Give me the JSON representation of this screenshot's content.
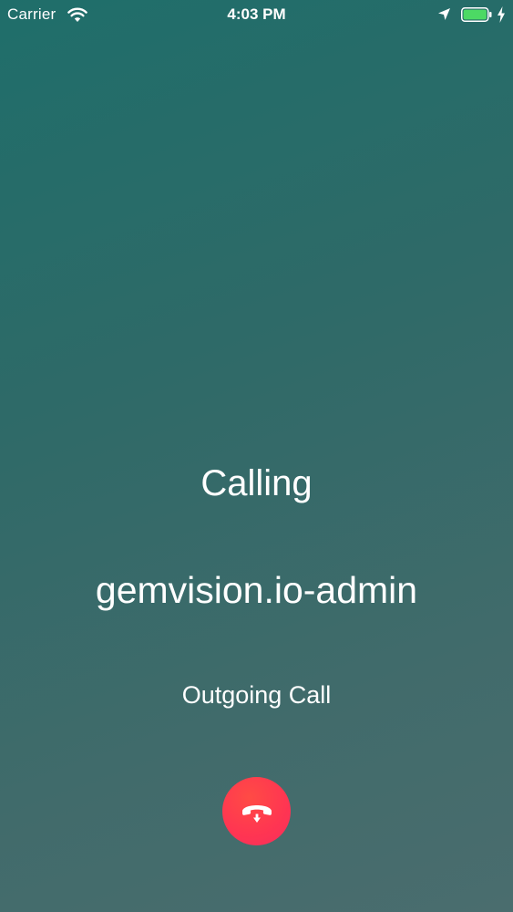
{
  "status_bar": {
    "carrier": "Carrier",
    "time": "4:03 PM",
    "wifi_icon": "wifi-icon",
    "location_icon": "location-arrow-icon",
    "battery_icon": "battery-icon",
    "charging_icon": "charging-bolt-icon",
    "battery_color": "#4cd964"
  },
  "call": {
    "title": "Calling",
    "callee": "gemvision.io-admin",
    "status": "Outgoing Call"
  },
  "end_call": {
    "icon": "phone-hangup-icon",
    "color": "#ff3b4f"
  }
}
